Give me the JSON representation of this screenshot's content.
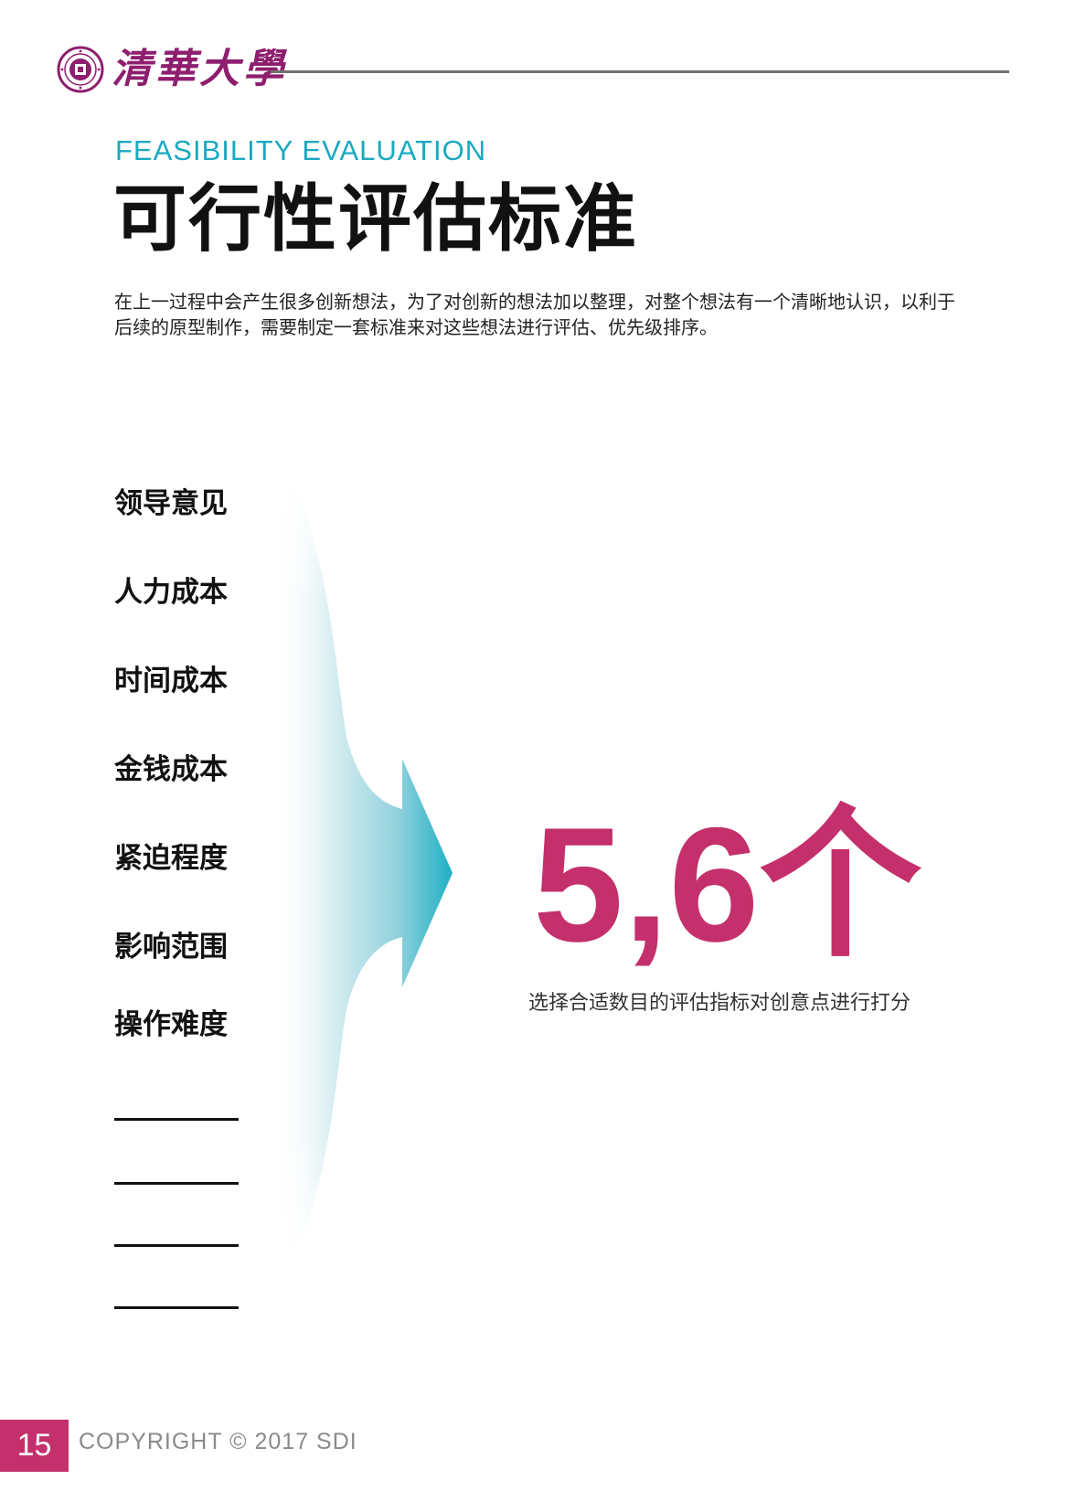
{
  "header": {
    "logo_text": "清華大學",
    "seal_icon": "tsinghua-seal-icon"
  },
  "heading": {
    "subtitle": "FEASIBILITY EVALUATION",
    "title": "可行性评估标准"
  },
  "intro": {
    "text": "在上一过程中会产生很多创新想法，为了对创新的想法加以整理，对整个想法有一个清晰地认识，以利于后续的原型制作，需要制定一套标准来对这些想法进行评估、优先级排序。"
  },
  "criteria": [
    "领导意见",
    "人力成本",
    "时间成本",
    "金钱成本",
    "紧迫程度",
    "影响范围",
    "操作难度"
  ],
  "result": {
    "big_number": "5,6个",
    "caption": "选择合适数目的评估指标对创意点进行打分"
  },
  "footer": {
    "page_number": "15",
    "copyright": "COPYRIGHT  © 2017 SDI"
  },
  "colors": {
    "accent": "#c4306b",
    "teal": "#1aa9c0",
    "logo_purple": "#8e1f6e",
    "rule_gray": "#707070"
  }
}
